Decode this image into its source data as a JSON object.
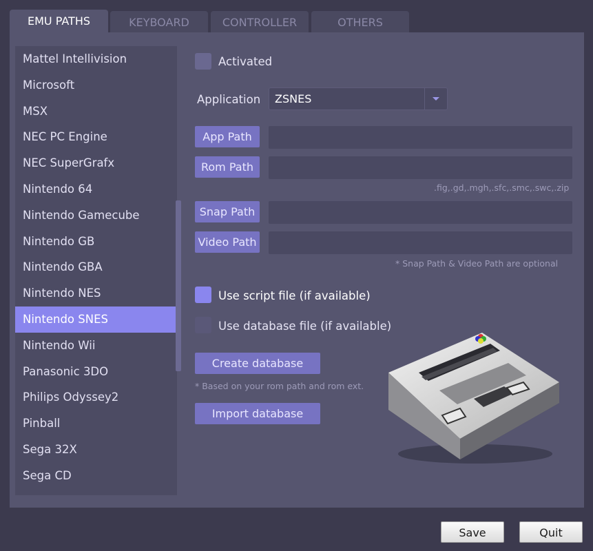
{
  "tabs": [
    "EMU PATHS",
    "KEYBOARD",
    "CONTROLLER",
    "OTHERS"
  ],
  "systems": [
    "Mattel Intellivision",
    "Microsoft",
    "MSX",
    "NEC PC Engine",
    "NEC SuperGrafx",
    "Nintendo 64",
    "Nintendo Gamecube",
    "Nintendo GB",
    "Nintendo GBA",
    "Nintendo NES",
    "Nintendo SNES",
    "Nintendo Wii",
    "Panasonic 3DO",
    "Philips Odyssey2",
    "Pinball",
    "Sega 32X",
    "Sega CD"
  ],
  "selected_system": "Nintendo SNES",
  "settings": {
    "activated_label": "Activated",
    "activated": false,
    "application_label": "Application",
    "application_value": "ZSNES",
    "app_path_label": "App Path",
    "app_path_value": "",
    "rom_path_label": "Rom Path",
    "rom_path_value": "",
    "rom_ext_hint": ".fig,.gd,.mgh,.sfc,.smc,.swc,.zip",
    "snap_path_label": "Snap Path",
    "snap_path_value": "",
    "video_path_label": "Video Path",
    "video_path_value": "",
    "optional_hint": "* Snap Path & Video Path are optional",
    "script_label": "Use script file (if available)",
    "script_checked": true,
    "database_label": "Use database file (if available)",
    "database_checked": false,
    "create_db_label": "Create database",
    "create_db_hint": "* Based on your rom path and rom ext.",
    "import_db_label": "Import database"
  },
  "footer": {
    "save_label": "Save",
    "quit_label": "Quit"
  },
  "colors": {
    "accent": "#8a86ee",
    "button": "#7773c2",
    "panel": "#56556f",
    "background": "#3c3a4e"
  },
  "console_image": "super-nintendo-console-icon"
}
